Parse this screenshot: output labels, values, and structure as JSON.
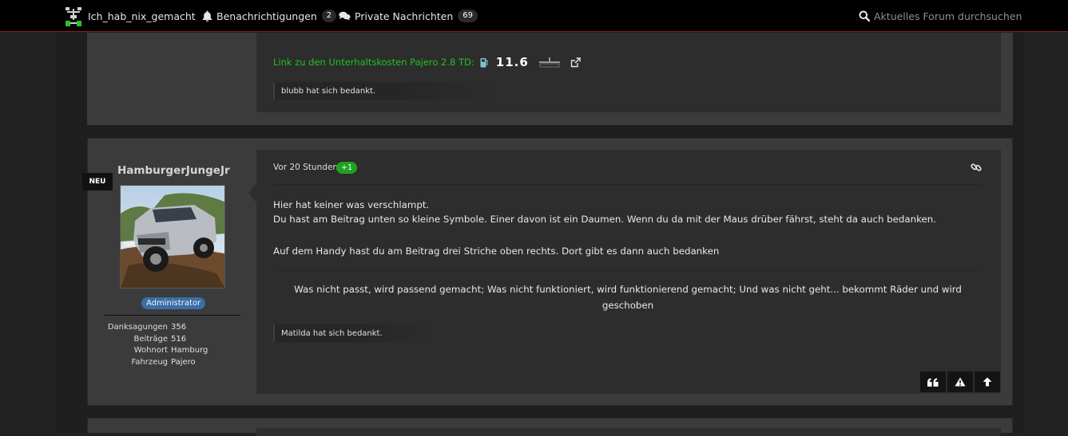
{
  "topbar": {
    "username": "Ich_hab_nix_gemacht",
    "notifications_label": "Benachrichtigungen",
    "notifications_count": "2",
    "messages_label": "Private Nachrichten",
    "messages_count": "69",
    "search_placeholder": "Aktuelles Forum durchsuchen"
  },
  "post_prev": {
    "signature_link": "Link zu den Unterhaltskosten Pajero 2.8 TD:",
    "fuel_value": "11.6",
    "thanks": "blubb hat sich bedankt."
  },
  "post": {
    "author": "HamburgerJungeJr",
    "new_label": "NEU",
    "role": "Administrator",
    "stats": {
      "danksagungen_label": "Danksagungen",
      "danksagungen": "356",
      "beitraege_label": "Beiträge",
      "beitraege": "516",
      "wohnort_label": "Wohnort",
      "wohnort": "Hamburg",
      "fahrzeug_label": "Fahrzeug",
      "fahrzeug": "Pajero"
    },
    "time": "Vor 20 Stunden",
    "vote": "+1",
    "body": {
      "line1": "Hier hat keiner was verschlampt.",
      "line2": "Du hast am Beitrag unten so kleine Symbole. Einer davon ist ein Daumen. Wenn du da mit der Maus drüber fährst, steht da auch bedanken.",
      "line3": "Auf dem Handy hast du am Beitrag drei Striche oben rechts. Dort gibt es dann auch bedanken"
    },
    "signature": "Was nicht passt, wird passend gemacht; Was nicht funktioniert, wird funktionierend gemacht; Und was nicht geht... bekommt Räder und wird geschoben",
    "thanks": "Matilda hat sich bedankt."
  },
  "colors": {
    "accent_line": "#8b1a1a",
    "link_green": "#1ec21e",
    "role_blue": "#3a6ea8",
    "vote_green": "#1fa21f"
  },
  "icons": [
    "app-logo-icon",
    "bell-icon",
    "chat-icon",
    "search-icon",
    "fuel-pump-icon",
    "external-link-icon",
    "permalink-icon",
    "quote-icon",
    "report-icon",
    "arrow-up-icon"
  ]
}
